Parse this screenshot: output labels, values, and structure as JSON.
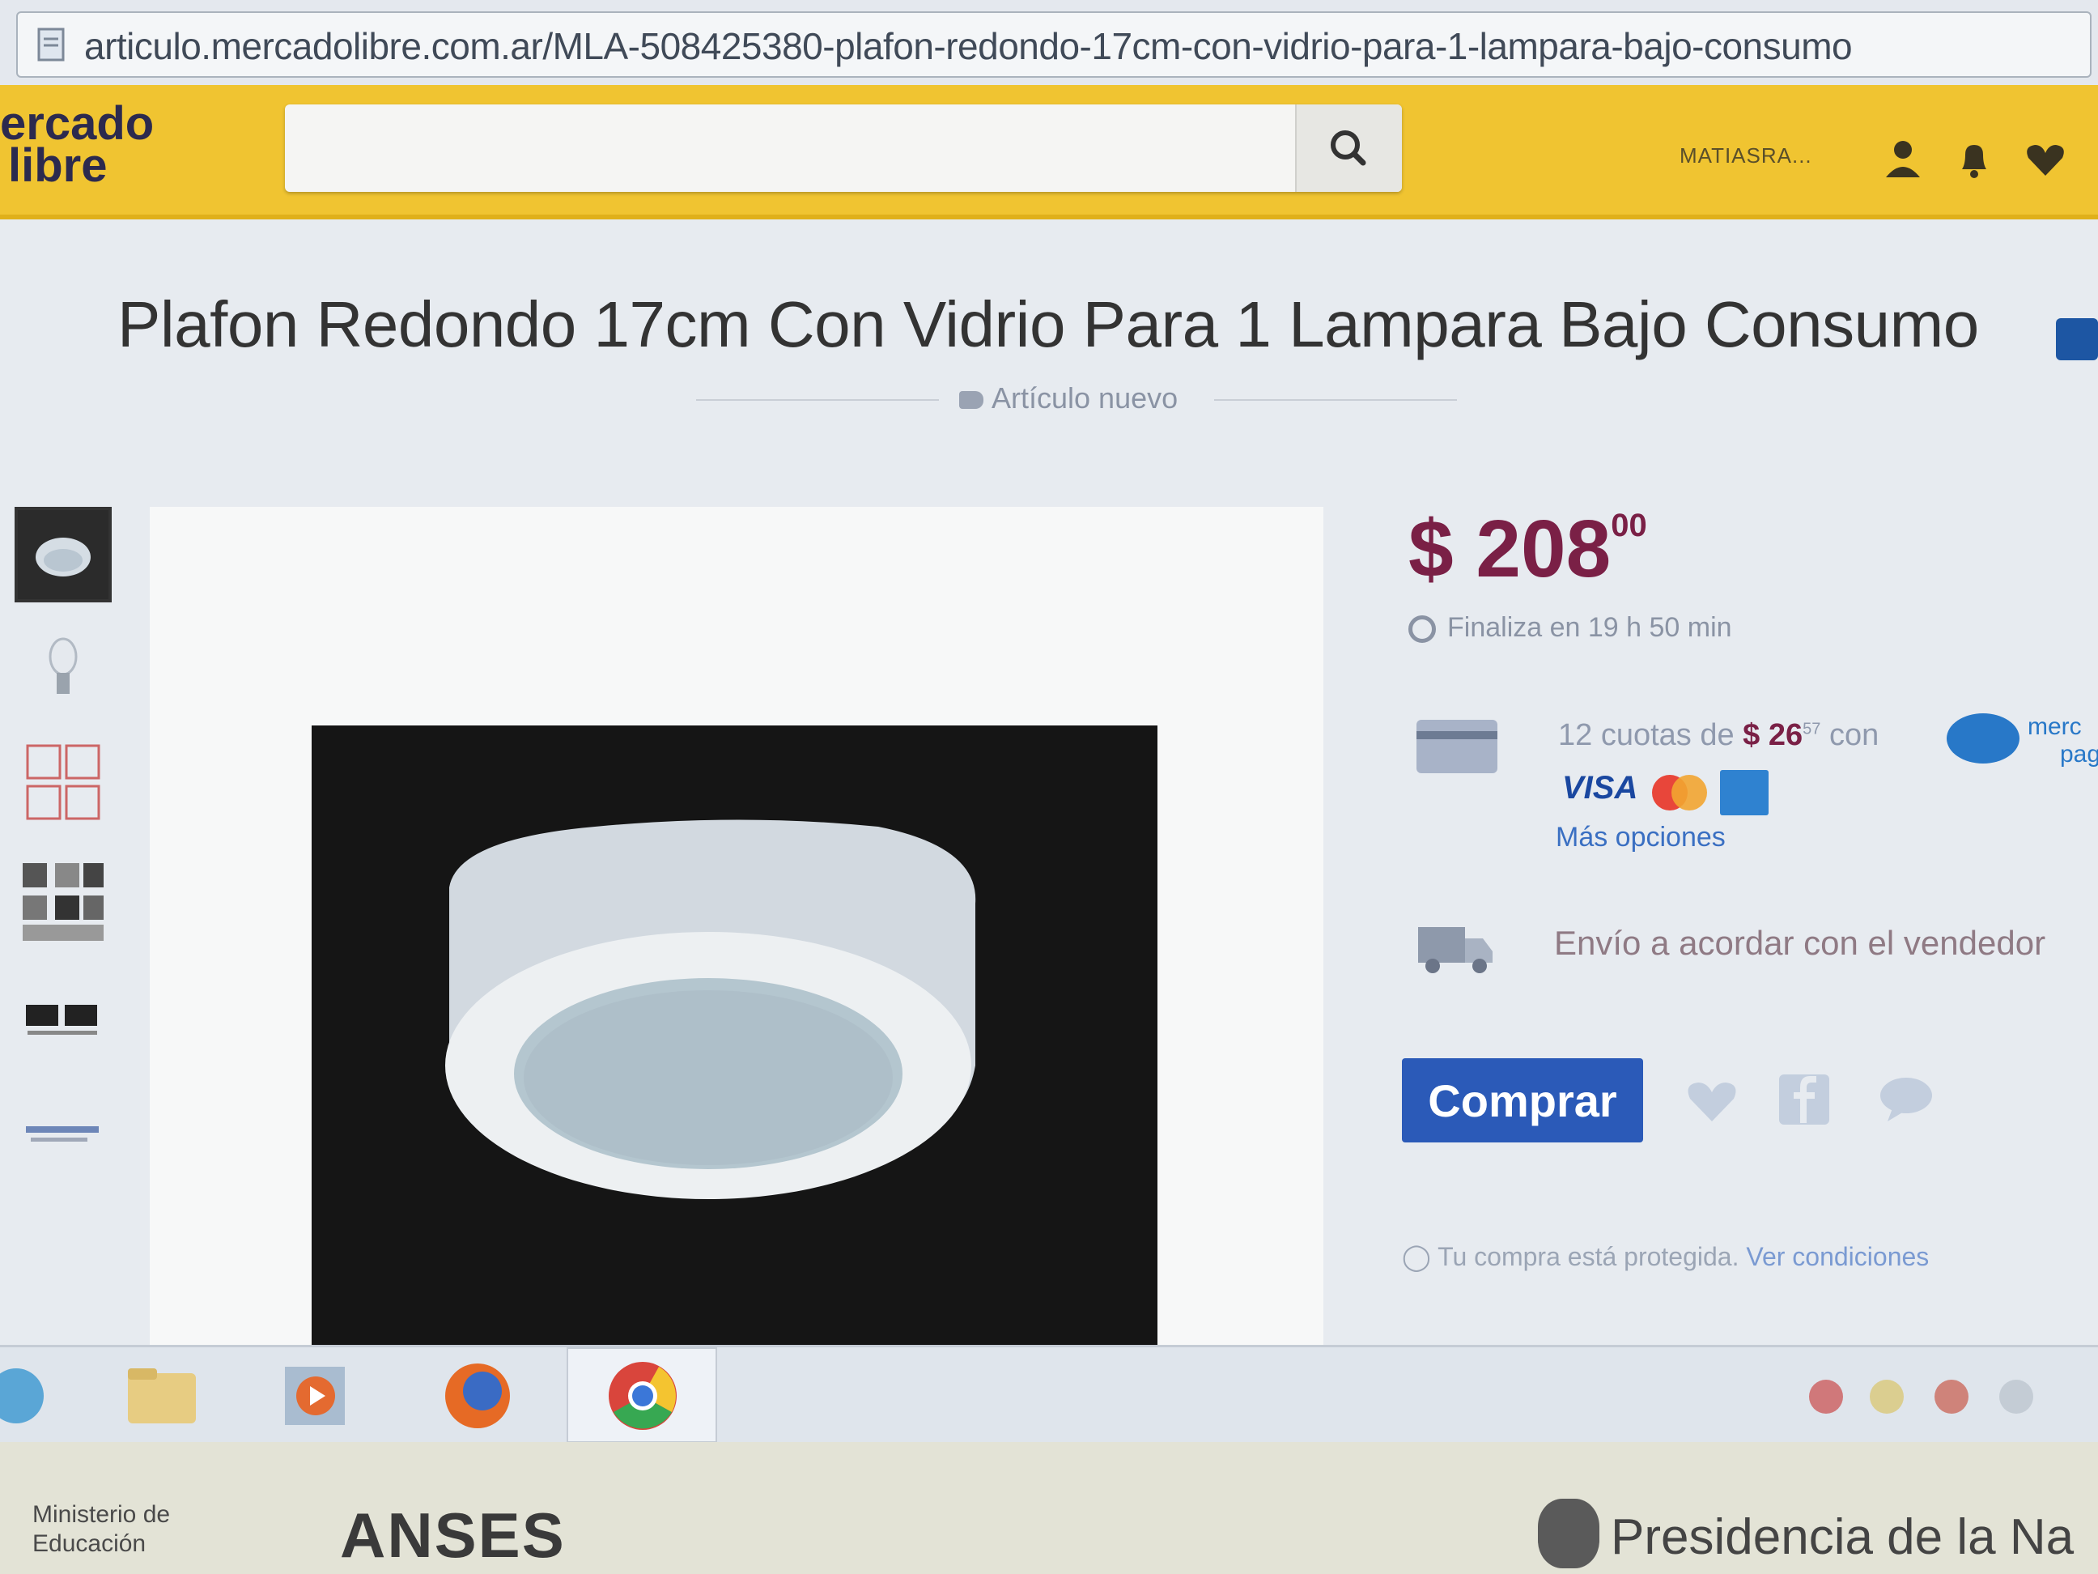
{
  "browser": {
    "url": "articulo.mercadolibre.com.ar/MLA-508425380-plafon-redondo-17cm-con-vidrio-para-1-lampara-bajo-consumo"
  },
  "header": {
    "logo_line1": "ercado",
    "logo_line2": "libre",
    "search_placeholder": "",
    "user_name": "MATIASRA..."
  },
  "product": {
    "title": "Plafon Redondo 17cm Con Vidrio Para 1 Lampara Bajo Consumo",
    "condition": "Artículo nuevo",
    "price_symbol": "$",
    "price_int": "208",
    "price_cents": "00",
    "ends_in": "Finaliza en 19 h 50 min",
    "installments_text": "12 cuotas de",
    "installment_amount": "$ 26",
    "installment_cents": "57",
    "installments_with": "con",
    "mp_text_1": "merc",
    "mp_text_2": "pag",
    "card_brand_visa": "VISA",
    "more_options": "Más opciones",
    "shipping": "Envío a acordar con el vendedor",
    "buy_label": "Comprar",
    "protected_text": "Tu compra está protegida.",
    "protected_link": "Ver condiciones"
  },
  "thumbnails": [
    "thumb-1",
    "thumb-2",
    "thumb-3",
    "thumb-4",
    "thumb-5",
    "thumb-6"
  ],
  "taskbar": {
    "icons": [
      "ie-icon",
      "folder-icon",
      "media-player-icon",
      "firefox-icon",
      "chrome-icon"
    ]
  },
  "bezel": {
    "ministerio_line1": "Ministerio de",
    "ministerio_line2": "Educación",
    "anses": "ANSES",
    "presidencia": "Presidencia de la Na"
  },
  "colors": {
    "ml_yellow": "#f0c431",
    "price": "#7a2046",
    "buy_button": "#2b5ab8",
    "link": "#3a6fc2"
  }
}
